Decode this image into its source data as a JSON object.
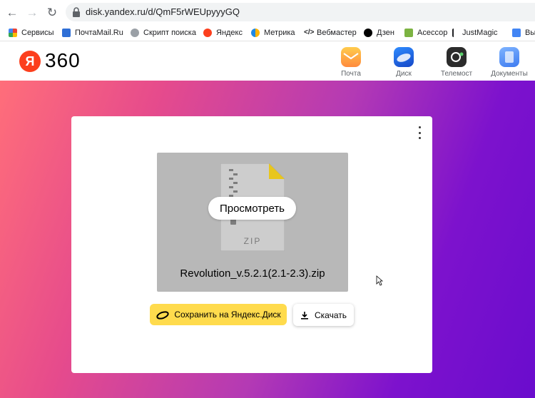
{
  "browser": {
    "url": "disk.yandex.ru/d/QmF5rWEUpyyyGQ",
    "bookmarks": [
      {
        "label": "Сервисы",
        "icon": "apps-grid-icon",
        "color": "#ea4335"
      },
      {
        "label": "ПочтаMail.Ru",
        "icon": "mailru-icon",
        "color": "#2f6fd6"
      },
      {
        "label": "Скрипт поиска",
        "icon": "globe-icon",
        "color": "#5f6368"
      },
      {
        "label": "Яндекс",
        "icon": "yandex-icon",
        "color": "#fc3f1d"
      },
      {
        "label": "Метрика",
        "icon": "metrika-icon",
        "color": "#ffb300"
      },
      {
        "label": "Вебмастер",
        "icon": "code-icon",
        "color": "#202124"
      },
      {
        "label": "Дзен",
        "icon": "dzen-icon",
        "color": "#000000"
      },
      {
        "label": "Асессор",
        "icon": "assessor-icon",
        "color": "#7cb342"
      },
      {
        "label": "JustMagic",
        "icon": "magic-icon",
        "color": "#202124"
      },
      {
        "label": "Вы",
        "icon": "grid-icon",
        "color": "#4285f4"
      }
    ]
  },
  "header": {
    "logo_letter": "Я",
    "logo_text": "360",
    "apps": [
      {
        "label": "Почта",
        "icon": "mail-icon"
      },
      {
        "label": "Диск",
        "icon": "disk-icon"
      },
      {
        "label": "Телемост",
        "icon": "telemost-icon"
      },
      {
        "label": "Документы",
        "icon": "documents-icon"
      }
    ]
  },
  "file": {
    "type_label": "ZIP",
    "preview_button": "Просмотреть",
    "name": "Revolution_v.5.2.1(2.1-2.3).zip"
  },
  "actions": {
    "save_label": "Сохранить на Яндекс.Диск",
    "download_label": "Скачать"
  },
  "colors": {
    "accent_yellow": "#ffdb4d",
    "yandex_red": "#fc3f1d",
    "gradient_start": "#ff6e7a",
    "gradient_end": "#6a0ccd"
  }
}
